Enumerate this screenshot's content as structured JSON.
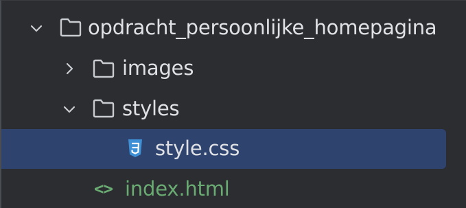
{
  "tree": {
    "items": [
      {
        "label": "opdracht_persoonlijke_homepagina",
        "type": "folder",
        "expanded": true,
        "icon": "folder-icon",
        "chevron": "chevron-down-icon"
      },
      {
        "label": "images",
        "type": "folder",
        "expanded": false,
        "icon": "folder-icon",
        "chevron": "chevron-right-icon"
      },
      {
        "label": "styles",
        "type": "folder",
        "expanded": true,
        "icon": "folder-icon",
        "chevron": "chevron-down-icon"
      },
      {
        "label": "style.css",
        "type": "file",
        "selected": true,
        "icon": "css-file-icon"
      },
      {
        "label": "index.html",
        "type": "file",
        "icon": "html-file-icon",
        "icon_text": "<>"
      }
    ]
  },
  "colors": {
    "background": "#2b2d30",
    "selection": "#2e436e",
    "text": "#dfe1e5",
    "html_file": "#6aab73",
    "css_icon": "#3d8fd6"
  }
}
